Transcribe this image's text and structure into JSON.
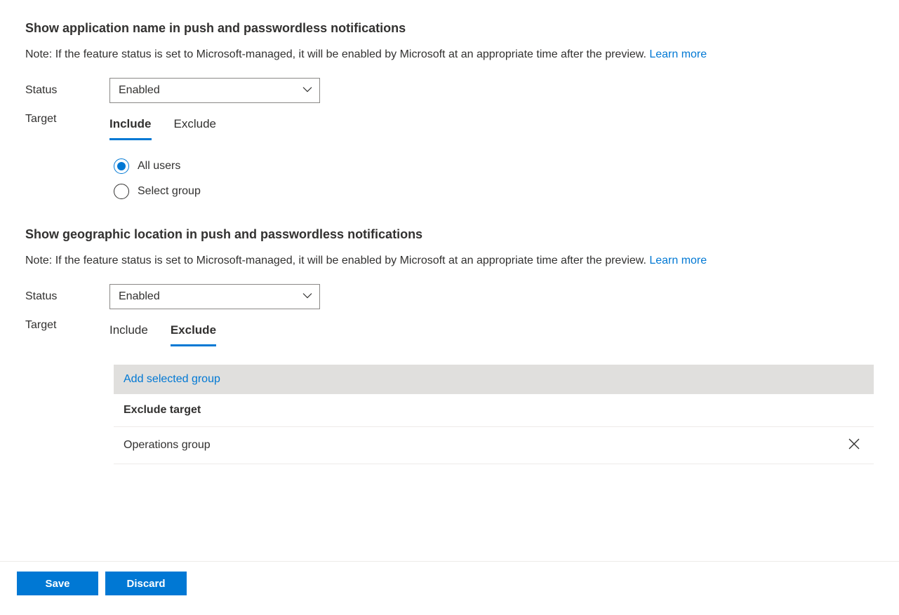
{
  "section1": {
    "title": "Show application name in push and passwordless notifications",
    "note": "Note: If the feature status is set to Microsoft-managed, it will be enabled by Microsoft at an appropriate time after the preview. ",
    "learn_more": "Learn more",
    "status_label": "Status",
    "status_value": "Enabled",
    "target_label": "Target",
    "tabs": {
      "include": "Include",
      "exclude": "Exclude"
    },
    "radios": {
      "all_users": "All users",
      "select_group": "Select group"
    }
  },
  "section2": {
    "title": "Show geographic location in push and passwordless notifications",
    "note": "Note: If the feature status is set to Microsoft-managed, it will be enabled by Microsoft at an appropriate time after the preview. ",
    "learn_more": "Learn more",
    "status_label": "Status",
    "status_value": "Enabled",
    "target_label": "Target",
    "tabs": {
      "include": "Include",
      "exclude": "Exclude"
    },
    "add_selected_group": "Add selected group",
    "exclude_header": "Exclude target",
    "excluded_items": [
      "Operations group"
    ]
  },
  "footer": {
    "save": "Save",
    "discard": "Discard"
  }
}
